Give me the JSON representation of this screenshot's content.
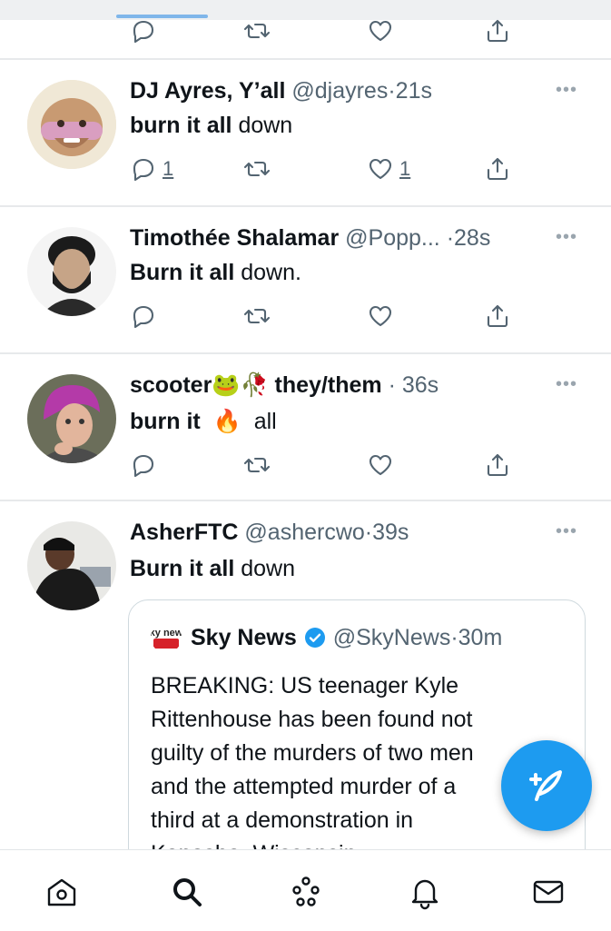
{
  "colors": {
    "accent": "#1d9bf0",
    "secondary_text": "#536471",
    "divider": "#e7e9eb"
  },
  "tweets": [
    {
      "name": "DJ Ayres, Y’all",
      "handle": "@djayres",
      "sep": "·",
      "time": "21s",
      "text_bold": "burn it all",
      "text_rest": " down",
      "replies": "1",
      "likes": "1"
    },
    {
      "name": "Timothée Shalamar",
      "handle": "@Popp...",
      "sep": "·",
      "time": "28s",
      "text_bold": "Burn it all",
      "text_rest": " down."
    },
    {
      "name": "scooter",
      "name_emoji": "🐸🥀",
      "name_rest": "they/them",
      "handle": "",
      "sep": "·",
      "time": "36s",
      "text_bold": "burn it",
      "text_emoji": "🔥",
      "text_rest": "all"
    },
    {
      "name": "AsherFTC",
      "handle": "@ashercwo",
      "sep": "·",
      "time": "39s",
      "text_bold": "Burn it all",
      "text_rest": " down"
    }
  ],
  "quote": {
    "logo_text": "sky news",
    "name": "Sky News",
    "handle": "@SkyNews",
    "sep": "·",
    "time": "30m",
    "lines": [
      "BREAKING: US teenager Kyle",
      "Rittenhouse has been found not",
      "guilty of the murders of two men",
      "and the attempted murder of a",
      "third at a demonstration in",
      "Kenosha, Wisconsin"
    ]
  },
  "more_label": "•••",
  "icons": [
    "reply-icon",
    "retweet-icon",
    "like-icon",
    "share-icon",
    "compose-icon",
    "home-icon",
    "search-icon",
    "spaces-icon",
    "notifications-icon",
    "messages-icon"
  ]
}
